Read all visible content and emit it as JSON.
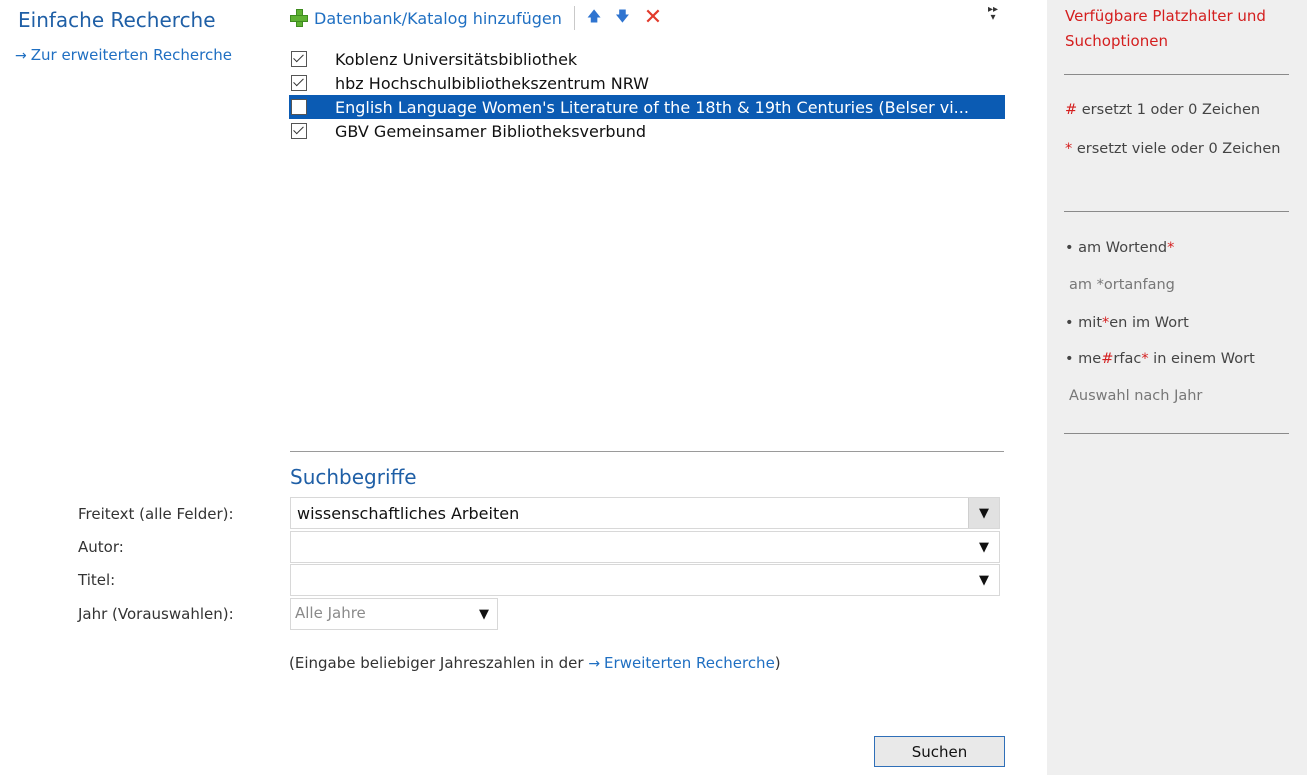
{
  "left": {
    "title": "Einfache Recherche",
    "adv_link": "Zur erweiterten Recherche"
  },
  "toolbar": {
    "add_label": "Datenbank/Katalog hinzufügen",
    "up": "🡅",
    "down": "🡇",
    "remove": "✕"
  },
  "databases": [
    {
      "name": "Koblenz Universitätsbibliothek",
      "checked": true,
      "selected": false
    },
    {
      "name": "hbz Hochschulbibliothekszentrum NRW",
      "checked": true,
      "selected": false
    },
    {
      "name": "English Language Women's Literature of the 18th & 19th Centuries (Belser vi...",
      "checked": false,
      "selected": true
    },
    {
      "name": "GBV Gemeinsamer Bibliotheksverbund",
      "checked": true,
      "selected": false
    }
  ],
  "search": {
    "section_title": "Suchbegriffe",
    "freetext_label": "Freitext (alle Felder):",
    "freetext_value": "wissenschaftliches Arbeiten",
    "author_label": "Autor:",
    "author_value": "",
    "title_label": "Titel:",
    "title_value": "",
    "year_label": "Jahr (Vorauswahlen):",
    "year_value": "Alle Jahre",
    "note_prefix": "(Eingabe beliebiger Jahreszahlen in der",
    "note_link": "Erweiterten Recherche",
    "note_suffix": ")",
    "submit": "Suchen"
  },
  "right_panel": {
    "title": "Verfügbare Platzhalter und Suchoptionen",
    "hash_symbol": "#",
    "hash_text": "ersetzt 1 oder 0 Zeichen",
    "star_symbol": "*",
    "star_text": "ersetzt viele oder 0 Zeichen",
    "ex1_a": "am Wortend",
    "ex1_b": "*",
    "ex2": "am *ortanfang",
    "ex3_a": "mit",
    "ex3_b": "*",
    "ex3_c": "en im Wort",
    "ex4_a": "me",
    "ex4_b": "#",
    "ex4_c": "rfac",
    "ex4_d": "*",
    "ex4_e": " in einem Wort",
    "ex5": "Auswahl nach Jahr"
  },
  "colors": {
    "accent": "#1f5fa6",
    "link": "#1f6fc2",
    "selection": "#0b5bb3",
    "wildcard_red": "#d41e1e",
    "panel_bg": "#efefef"
  }
}
